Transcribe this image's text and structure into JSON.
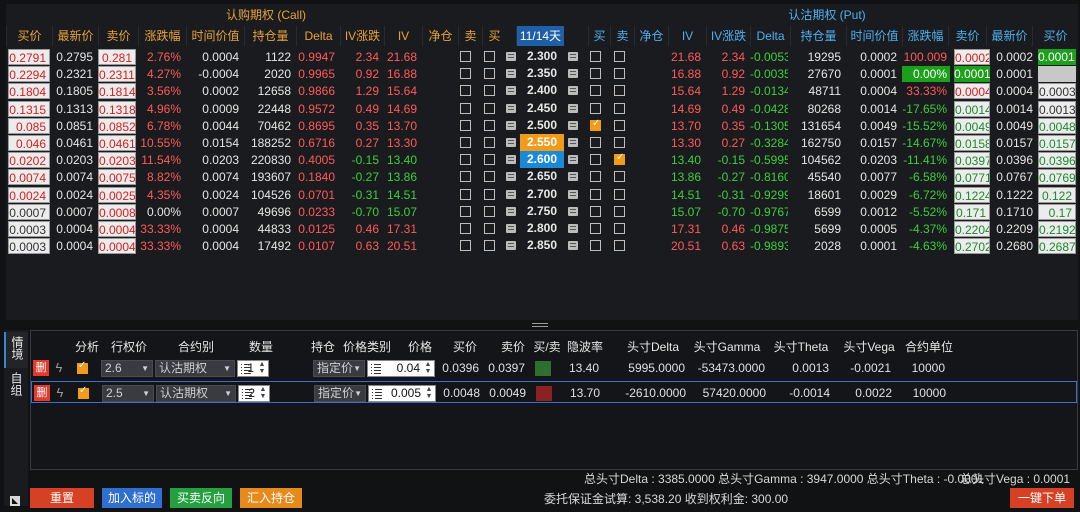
{
  "chain": {
    "call_title": "认购期权 (Call)",
    "put_title": "认沽期权 (Put)",
    "call_headers": [
      "买价",
      "最新价",
      "卖价",
      "涨跌幅",
      "时间价值",
      "持仓量",
      "Delta",
      "IV涨跌",
      "IV",
      "净仓",
      "卖",
      "买"
    ],
    "expiry": "11/14天",
    "put_headers": [
      "买",
      "卖",
      "净仓",
      "IV",
      "IV涨跌",
      "Delta",
      "持仓量",
      "时间价值",
      "涨跌幅",
      "卖价",
      "最新价",
      "买价"
    ],
    "rows": [
      {
        "strike": "2.300",
        "c_bid": "0.2791",
        "c_last": "0.2795",
        "c_ask": "0.281",
        "c_chg": "2.76%",
        "c_tv": "0.0004",
        "c_oi": "1122",
        "c_delta": "0.9947",
        "c_ivchg": "2.34",
        "c_iv": "21.68",
        "p_iv": "21.68",
        "p_ivchg": "2.34",
        "p_delta": "-0.0053",
        "p_oi": "19295",
        "p_tv": "0.0002",
        "p_chg": "100.009",
        "p_ask": "0.0002",
        "p_last": "0.0002",
        "p_bid": "0.0001"
      },
      {
        "strike": "2.350",
        "c_bid": "0.2294",
        "c_last": "0.2321",
        "c_ask": "0.2311",
        "c_chg": "4.27%",
        "c_tv": "-0.0004",
        "c_oi": "2020",
        "c_delta": "0.9965",
        "c_ivchg": "0.92",
        "c_iv": "16.88",
        "p_iv": "16.88",
        "p_ivchg": "0.92",
        "p_delta": "-0.0035",
        "p_oi": "27670",
        "p_tv": "0.0001",
        "p_chg": "0.00%",
        "p_ask": "0.0001",
        "p_last": "0.0001",
        "p_bid": ""
      },
      {
        "strike": "2.400",
        "c_bid": "0.1804",
        "c_last": "0.1805",
        "c_ask": "0.1814",
        "c_chg": "3.56%",
        "c_tv": "0.0002",
        "c_oi": "12658",
        "c_delta": "0.9866",
        "c_ivchg": "1.29",
        "c_iv": "15.64",
        "p_iv": "15.64",
        "p_ivchg": "1.29",
        "p_delta": "-0.0134",
        "p_oi": "48711",
        "p_tv": "0.0004",
        "p_chg": "33.33%",
        "p_ask": "0.0004",
        "p_last": "0.0004",
        "p_bid": "0.0003"
      },
      {
        "strike": "2.450",
        "c_bid": "0.1315",
        "c_last": "0.1313",
        "c_ask": "0.1318",
        "c_chg": "4.96%",
        "c_tv": "0.0009",
        "c_oi": "22448",
        "c_delta": "0.9572",
        "c_ivchg": "0.49",
        "c_iv": "14.69",
        "p_iv": "14.69",
        "p_ivchg": "0.49",
        "p_delta": "-0.0428",
        "p_oi": "80268",
        "p_tv": "0.0014",
        "p_chg": "-17.65%",
        "p_ask": "0.0014",
        "p_last": "0.0014",
        "p_bid": "0.0013"
      },
      {
        "strike": "2.500",
        "c_bid": "0.085",
        "c_last": "0.0851",
        "c_ask": "0.0852",
        "c_chg": "6.78%",
        "c_tv": "0.0044",
        "c_oi": "70462",
        "c_delta": "0.8695",
        "c_ivchg": "0.35",
        "c_iv": "13.70",
        "p_iv": "13.70",
        "p_ivchg": "0.35",
        "p_delta": "-0.1305",
        "p_oi": "131654",
        "p_tv": "0.0049",
        "p_chg": "-15.52%",
        "p_ask": "0.0049",
        "p_last": "0.0049",
        "p_bid": "0.0048"
      },
      {
        "strike": "2.550",
        "c_bid": "0.046",
        "c_last": "0.0461",
        "c_ask": "0.0461",
        "c_chg": "10.55%",
        "c_tv": "0.0154",
        "c_oi": "188252",
        "c_delta": "0.6716",
        "c_ivchg": "0.27",
        "c_iv": "13.30",
        "p_iv": "13.30",
        "p_ivchg": "0.27",
        "p_delta": "-0.3284",
        "p_oi": "162750",
        "p_tv": "0.0157",
        "p_chg": "-14.67%",
        "p_ask": "0.0158",
        "p_last": "0.0157",
        "p_bid": "0.0157"
      },
      {
        "strike": "2.600",
        "c_bid": "0.0202",
        "c_last": "0.0203",
        "c_ask": "0.0203",
        "c_chg": "11.54%",
        "c_tv": "0.0203",
        "c_oi": "220830",
        "c_delta": "0.4005",
        "c_ivchg": "-0.15",
        "c_iv": "13.40",
        "p_iv": "13.40",
        "p_ivchg": "-0.15",
        "p_delta": "-0.5995",
        "p_oi": "104562",
        "p_tv": "0.0203",
        "p_chg": "-11.41%",
        "p_ask": "0.0397",
        "p_last": "0.0396",
        "p_bid": "0.0396"
      },
      {
        "strike": "2.650",
        "c_bid": "0.0074",
        "c_last": "0.0074",
        "c_ask": "0.0075",
        "c_chg": "8.82%",
        "c_tv": "0.0074",
        "c_oi": "193607",
        "c_delta": "0.1840",
        "c_ivchg": "-0.27",
        "c_iv": "13.86",
        "p_iv": "13.86",
        "p_ivchg": "-0.27",
        "p_delta": "-0.8160",
        "p_oi": "45540",
        "p_tv": "0.0077",
        "p_chg": "-6.58%",
        "p_ask": "0.0771",
        "p_last": "0.0767",
        "p_bid": "0.0769"
      },
      {
        "strike": "2.700",
        "c_bid": "0.0024",
        "c_last": "0.0024",
        "c_ask": "0.0025",
        "c_chg": "4.35%",
        "c_tv": "0.0024",
        "c_oi": "104526",
        "c_delta": "0.0701",
        "c_ivchg": "-0.31",
        "c_iv": "14.51",
        "p_iv": "14.51",
        "p_ivchg": "-0.31",
        "p_delta": "-0.9299",
        "p_oi": "18601",
        "p_tv": "0.0029",
        "p_chg": "-6.72%",
        "p_ask": "0.1224",
        "p_last": "0.1222",
        "p_bid": "0.122"
      },
      {
        "strike": "2.750",
        "c_bid": "0.0007",
        "c_last": "0.0007",
        "c_ask": "0.0008",
        "c_chg": "0.00%",
        "c_tv": "0.0007",
        "c_oi": "49696",
        "c_delta": "0.0233",
        "c_ivchg": "-0.70",
        "c_iv": "15.07",
        "p_iv": "15.07",
        "p_ivchg": "-0.70",
        "p_delta": "-0.9767",
        "p_oi": "6599",
        "p_tv": "0.0012",
        "p_chg": "-5.52%",
        "p_ask": "0.171",
        "p_last": "0.1710",
        "p_bid": "0.17"
      },
      {
        "strike": "2.800",
        "c_bid": "0.0003",
        "c_last": "0.0004",
        "c_ask": "0.0004",
        "c_chg": "33.33%",
        "c_tv": "0.0004",
        "c_oi": "44833",
        "c_delta": "0.0125",
        "c_ivchg": "0.46",
        "c_iv": "17.31",
        "p_iv": "17.31",
        "p_ivchg": "0.46",
        "p_delta": "-0.9875",
        "p_oi": "5699",
        "p_tv": "0.0005",
        "p_chg": "-4.37%",
        "p_ask": "0.2204",
        "p_last": "0.2209",
        "p_bid": "0.2192"
      },
      {
        "strike": "2.850",
        "c_bid": "0.0003",
        "c_last": "0.0004",
        "c_ask": "0.0004",
        "c_chg": "33.33%",
        "c_tv": "0.0004",
        "c_oi": "17492",
        "c_delta": "0.0107",
        "c_ivchg": "0.63",
        "c_iv": "20.51",
        "p_iv": "20.51",
        "p_ivchg": "0.63",
        "p_delta": "-0.9893",
        "p_oi": "2028",
        "p_tv": "0.0001",
        "p_chg": "-4.63%",
        "p_ask": "0.2702",
        "p_last": "0.2680",
        "p_bid": "0.2687"
      }
    ],
    "checked": {
      "call_sell_row": 4,
      "put_sell_row": 6
    }
  },
  "side_tabs": [
    "情境",
    "自组"
  ],
  "strategy": {
    "headers": [
      "分析",
      "行权价",
      "合约别",
      "数量",
      "持仓",
      "价格类别",
      "价格",
      "买价",
      "卖价",
      "买/卖",
      "隐波率",
      "头寸Delta",
      "头寸Gamma",
      "头寸Theta",
      "头寸Vega",
      "合约单位"
    ],
    "delete_label": "删",
    "rows": [
      {
        "strike": "2.6",
        "type": "认沽期权",
        "qty": "1",
        "price_type": "指定价",
        "price": "0.04",
        "bid": "0.0396",
        "ask": "0.0397",
        "side": "sell",
        "iv": "13.40",
        "delta": "5995.0000",
        "gamma": "-53473.0000",
        "theta": "0.0013",
        "vega": "-0.0021",
        "unit": "10000"
      },
      {
        "strike": "2.5",
        "type": "认沽期权",
        "qty": "2",
        "price_type": "指定价",
        "price": "0.005",
        "bid": "0.0048",
        "ask": "0.0049",
        "side": "buy",
        "iv": "13.70",
        "delta": "-2610.0000",
        "gamma": "57420.0000",
        "theta": "-0.0014",
        "vega": "0.0022",
        "unit": "10000"
      }
    ]
  },
  "summary": {
    "line": "总头寸Delta : 3385.0000 总头寸Gamma : 3947.0000 总头寸Theta : -0.0001",
    "vega": "总头寸Vega : 0.0001",
    "margin": "委托保证金试算: 3,538.20 收到权利金: 300.00"
  },
  "buttons": {
    "reset": "重置",
    "add_underlying": "加入标的",
    "reverse": "买卖反向",
    "import_pos": "汇入持仓",
    "order": "一键下单"
  },
  "colors": {
    "call_header": "#e8a33b",
    "put_header": "#4fb0f0",
    "up": "#ff5a5a",
    "down": "#3ccf3c",
    "accent_orange": "#f29a1a",
    "accent_blue": "#1a8ad8"
  }
}
